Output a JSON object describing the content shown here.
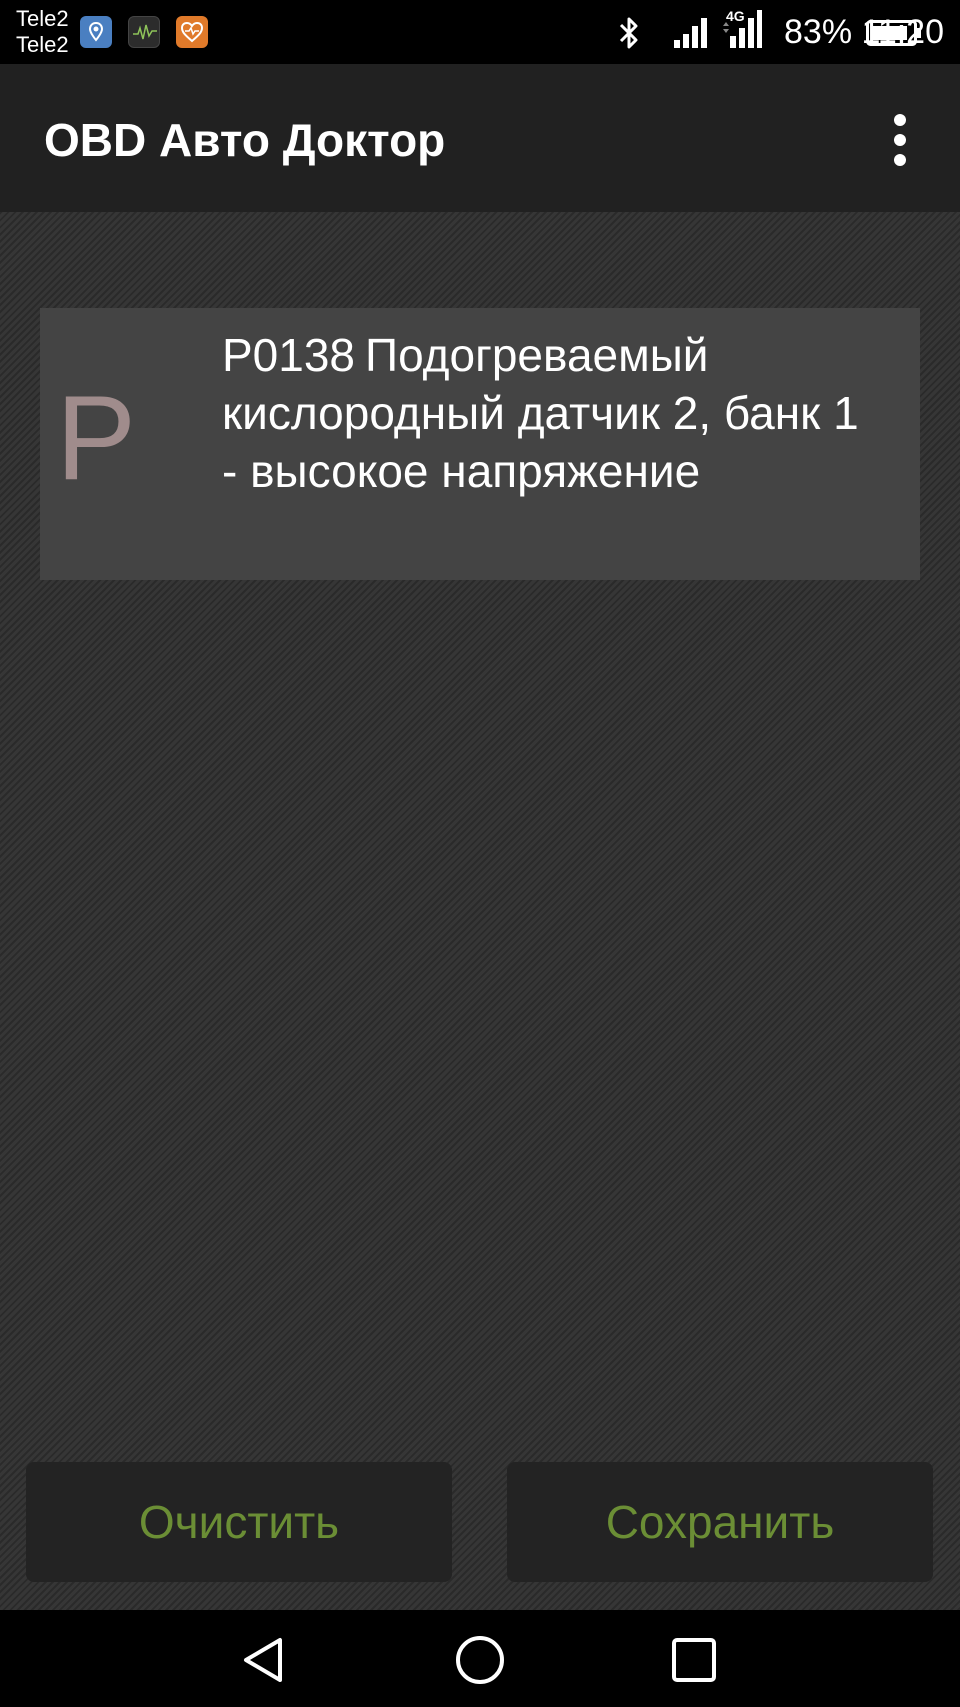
{
  "status_bar": {
    "carrier_1": "Tele2",
    "carrier_2": "Tele2",
    "network_type": "4G",
    "battery_percent": "83%",
    "time": "11:20",
    "icons": [
      "location-icon",
      "monitor-icon",
      "health-icon",
      "bluetooth-icon",
      "signal-icon",
      "signal-4g-icon",
      "battery-icon"
    ]
  },
  "app_bar": {
    "title": "OBD Авто Доктор",
    "menu_icon": "more-vertical-icon"
  },
  "dtc": {
    "letter": "P",
    "code": "P0138",
    "description": "Подогреваемый кислородный датчик 2, банк 1 - высокое напряжение"
  },
  "actions": {
    "clear_label": "Очистить",
    "save_label": "Сохранить"
  },
  "colors": {
    "accent": "#6b8e35",
    "app_bar": "#212121",
    "card": "#444444",
    "letter": "#a08c8c"
  },
  "nav_bar": {
    "icons": [
      "back-icon",
      "home-icon",
      "recent-apps-icon"
    ]
  }
}
